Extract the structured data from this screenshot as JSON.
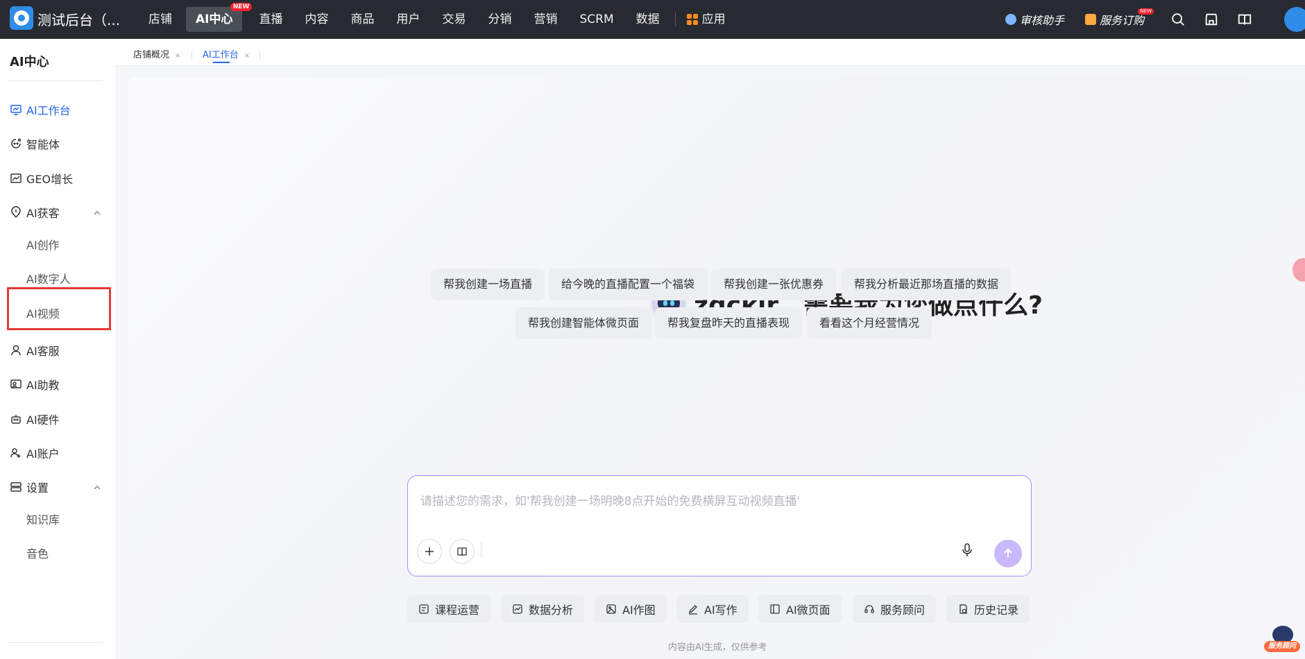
{
  "topbar": {
    "brand": "测试后台（...",
    "nav": [
      {
        "label": "店铺"
      },
      {
        "label": "AI中心",
        "badge": "NEW",
        "active": true
      },
      {
        "label": "直播"
      },
      {
        "label": "内容"
      },
      {
        "label": "商品"
      },
      {
        "label": "用户"
      },
      {
        "label": "交易"
      },
      {
        "label": "分销"
      },
      {
        "label": "营销"
      },
      {
        "label": "SCRM"
      },
      {
        "label": "数据"
      }
    ],
    "apps_label": "应用",
    "review_helper": "审核助手",
    "service_order": "服务订购",
    "service_badge": "NEW"
  },
  "sidebar": {
    "title": "AI中心",
    "items": [
      {
        "label": "AI工作台",
        "icon": "monitor-icon",
        "active": true
      },
      {
        "label": "智能体",
        "icon": "agent-icon"
      },
      {
        "label": "GEO增长",
        "icon": "chart-icon"
      },
      {
        "label": "AI获客",
        "icon": "location-icon",
        "expanded": true
      },
      {
        "label": "AI创作"
      },
      {
        "label": "AI数字人"
      },
      {
        "label": "AI视频"
      },
      {
        "label": "AI客服",
        "icon": "user-icon"
      },
      {
        "label": "AI助教",
        "icon": "teacher-icon"
      },
      {
        "label": "AI硬件",
        "icon": "robot-icon"
      },
      {
        "label": "AI账户",
        "icon": "user-plus-icon"
      },
      {
        "label": "设置",
        "icon": "settings-icon",
        "expanded": true
      },
      {
        "label": "知识库"
      },
      {
        "label": "音色"
      }
    ]
  },
  "tabs": [
    {
      "label": "店铺概况",
      "close": "×"
    },
    {
      "label": "AI工作台",
      "close": "×",
      "active": true
    }
  ],
  "main": {
    "greeting": "zgckjr，需要我为您做点什么?",
    "suggestions_row1": [
      "帮我创建一场直播",
      "给今晚的直播配置一个福袋",
      "帮我创建一张优惠券",
      "帮我分析最近那场直播的数据"
    ],
    "suggestions_row2": [
      "帮我创建智能体微页面",
      "帮我复盘昨天的直播表现",
      "看看这个月经营情况"
    ],
    "input_placeholder": "请描述您的需求，如'帮我创建一场明晚8点开始的免费横屏互动视频直播'",
    "tools": [
      "课程运营",
      "数据分析",
      "AI作图",
      "AI写作",
      "AI微页面",
      "服务顾问",
      "历史记录"
    ],
    "footnote": "内容由AI生成，仅供参考"
  },
  "float": {
    "service_label": "服务顾问"
  },
  "colors": {
    "accent": "#2463eb",
    "topbar": "#272a30",
    "highlight": "#e53935",
    "send": "#c9b8fb"
  }
}
